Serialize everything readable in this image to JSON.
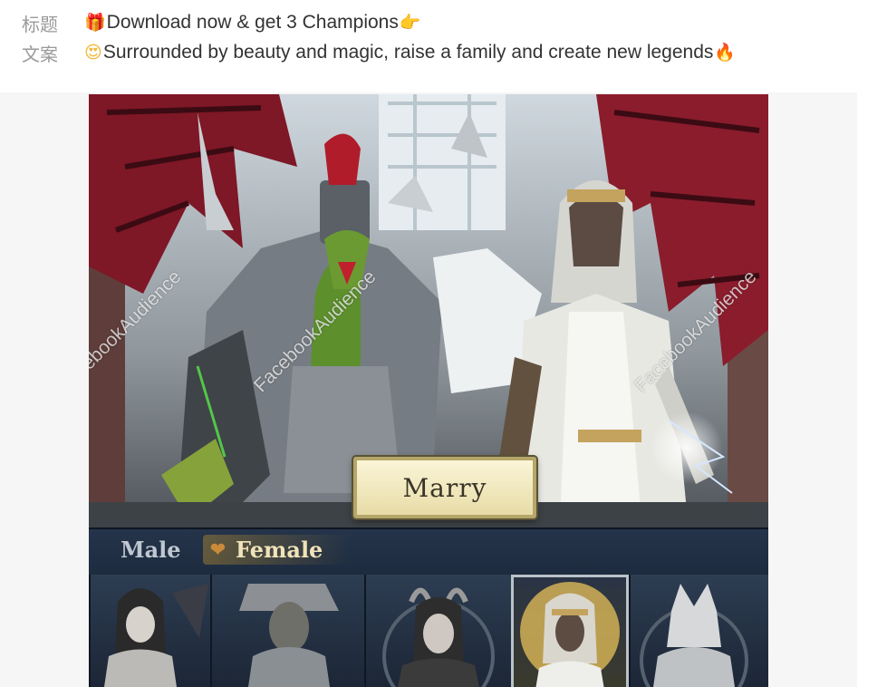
{
  "meta": {
    "title_label": "标题",
    "copy_label": "文案",
    "title_text": "Download now & get 3 Champions",
    "copy_text": "Surrounded by beauty and magic, raise a family and create new legends"
  },
  "icons": {
    "gift": "🎁",
    "pointing_hand": "👉",
    "heart_eyes": "😍",
    "fire": "🔥",
    "heart": "❤"
  },
  "media": {
    "marry_button": "Marry",
    "tabs": {
      "male": "Male",
      "female": "Female"
    },
    "watermark": "FacebookAudience",
    "selected_card_index": 3
  },
  "colors": {
    "label_gray": "#9a9a9a",
    "text": "#333333",
    "button_face": "#f3ebc3",
    "tab_bar": "#22324a"
  }
}
